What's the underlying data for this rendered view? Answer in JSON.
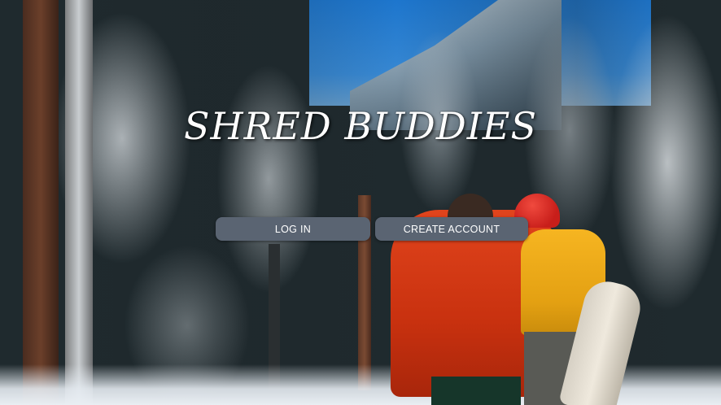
{
  "page": {
    "title": "SHRED BUDDIES"
  },
  "actions": {
    "login_label": "LOG IN",
    "create_account_label": "CREATE ACCOUNT"
  },
  "colors": {
    "button_bg": "#5a6472",
    "button_text": "#ffffff",
    "title_text": "#ffffff"
  }
}
